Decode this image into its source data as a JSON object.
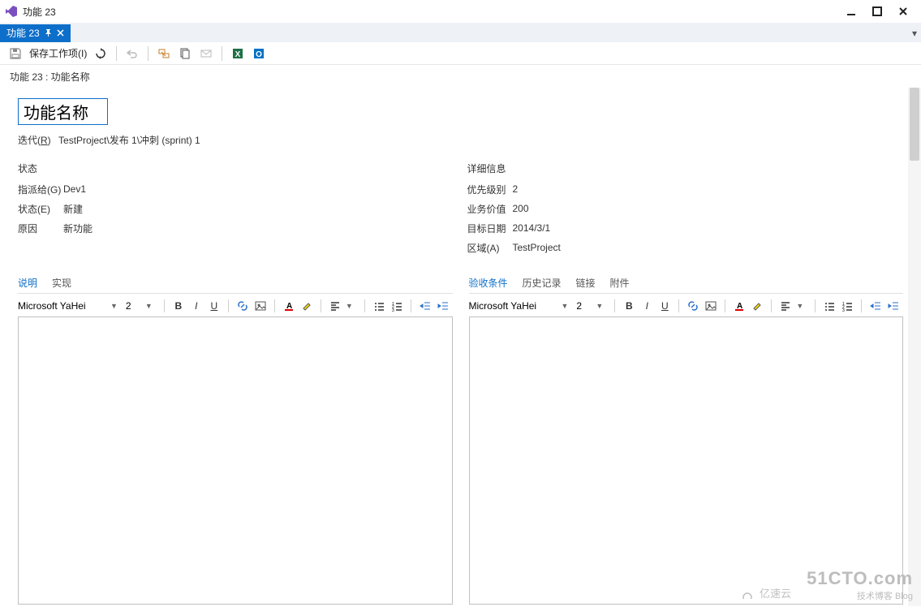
{
  "window": {
    "title": "功能 23"
  },
  "tab": {
    "label": "功能 23"
  },
  "toolbar": {
    "save_label": "保存工作项(I)"
  },
  "breadcrumb": "功能 23 : 功能名称",
  "work_item": {
    "title_value": "功能名称",
    "iteration_label_pre": "迭代(",
    "iteration_label_key": "R",
    "iteration_label_post": ")",
    "iteration_value": "TestProject\\发布 1\\冲刺 (sprint) 1"
  },
  "left": {
    "section_title": "状态",
    "fields": {
      "assigned_label_pre": "指派给(",
      "assigned_key": "G",
      "assigned_post": ")",
      "assigned_value": "Dev1",
      "state_label_pre": "状态(",
      "state_key": "E",
      "state_post": ")",
      "state_value": "新建",
      "reason_label": "原因",
      "reason_value": "新功能"
    }
  },
  "right": {
    "section_title": "详细信息",
    "fields": {
      "priority_label": "优先级别",
      "priority_value": "2",
      "bizvalue_label": "业务价值",
      "bizvalue_value": "200",
      "targetdate_label": "目标日期",
      "targetdate_value": "2014/3/1",
      "area_label_pre": "区域(",
      "area_key": "A",
      "area_post": ")",
      "area_value": "TestProject"
    }
  },
  "desc_tabs": {
    "desc": "说明",
    "impl": "实现"
  },
  "acc_tabs": {
    "acc": "验收条件",
    "history": "历史记录",
    "links": "链接",
    "attach": "附件"
  },
  "editor": {
    "font": "Microsoft YaHei",
    "size": "2"
  },
  "watermark": {
    "line1": "51CTO.com",
    "line2": "技术博客   Blog",
    "brand": "亿速云"
  }
}
